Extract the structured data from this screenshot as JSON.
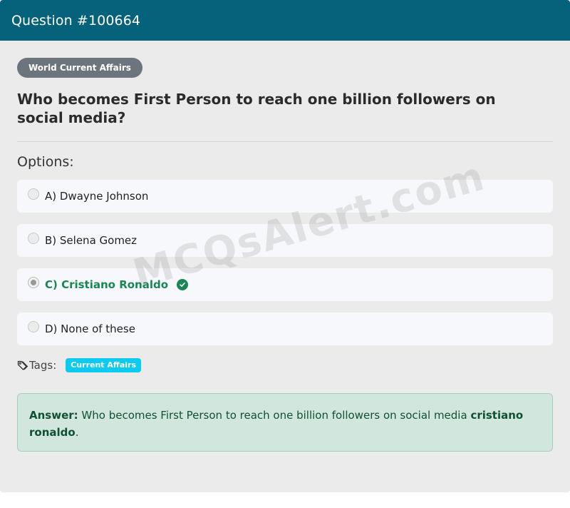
{
  "header": {
    "title": "Question #100664"
  },
  "question": {
    "category": "World Current Affairs",
    "text": "Who becomes First Person to reach one billion followers on social media?"
  },
  "options": {
    "heading": "Options:",
    "items": [
      {
        "label": "A) Dwayne Johnson",
        "selected": false,
        "correct": false
      },
      {
        "label": "B) Selena Gomez",
        "selected": false,
        "correct": false
      },
      {
        "label": "C) Cristiano Ronaldo",
        "selected": true,
        "correct": true
      },
      {
        "label": "D) None of these",
        "selected": false,
        "correct": false
      }
    ]
  },
  "tags": {
    "label": "Tags:",
    "items": [
      "Current Affairs"
    ]
  },
  "answer": {
    "prefix": "Answer:",
    "text": " Who becomes First Person to reach one billion followers on social media ",
    "value": "cristiano ronaldo",
    "suffix": "."
  },
  "watermark": "MCQsAlert.com",
  "colors": {
    "header_bg": "#05627a",
    "correct": "#198754",
    "tag_badge": "#0dcaf0",
    "category_badge": "#6c757d",
    "answer_bg": "#d1e7dd"
  },
  "icons": {
    "tag": "tag-icon",
    "check": "check-circle-icon"
  }
}
